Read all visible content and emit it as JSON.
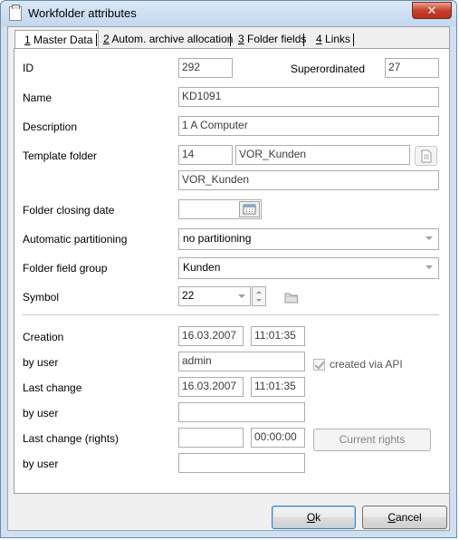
{
  "window": {
    "title": "Workfolder attributes",
    "close_label": "✕"
  },
  "tabs": [
    {
      "key": "1",
      "label": " Master Data"
    },
    {
      "key": "2",
      "label": " Autom. archive allocation"
    },
    {
      "key": "3",
      "label": " Folder fields"
    },
    {
      "key": "4",
      "label": " Links"
    }
  ],
  "labels": {
    "id": "ID",
    "superordinated": "Superordinated",
    "name": "Name",
    "description": "Description",
    "template_folder": "Template folder",
    "folder_closing_date": "Folder closing date",
    "automatic_partitioning": "Automatic partitioning",
    "folder_field_group": "Folder field group",
    "symbol": "Symbol",
    "creation": "Creation",
    "by_user_1": "by user",
    "last_change": "Last change",
    "by_user_2": "by user",
    "last_change_rights": "Last change (rights)",
    "by_user_3": "by user",
    "created_via_api": "created via API"
  },
  "values": {
    "id": "292",
    "superordinated": "27",
    "name": "KD1091",
    "description": "1 A Computer",
    "template_id": "14",
    "template_name": "VOR_Kunden",
    "template_path": "VOR_Kunden",
    "folder_closing_date": "",
    "automatic_partitioning": "no partitioning",
    "folder_field_group": "Kunden",
    "symbol": "22",
    "creation_date": "16.03.2007",
    "creation_time": "11:01:35",
    "creation_user": "admin",
    "last_change_date": "16.03.2007",
    "last_change_time": "11:01:35",
    "last_change_user": "",
    "rights_date": "",
    "rights_time": "00:00:00",
    "rights_user": "",
    "created_via_api": true
  },
  "buttons": {
    "current_rights": "Current rights",
    "ok_key": "O",
    "ok_rest": "k",
    "cancel_key": "C",
    "cancel_rest": "ancel"
  }
}
